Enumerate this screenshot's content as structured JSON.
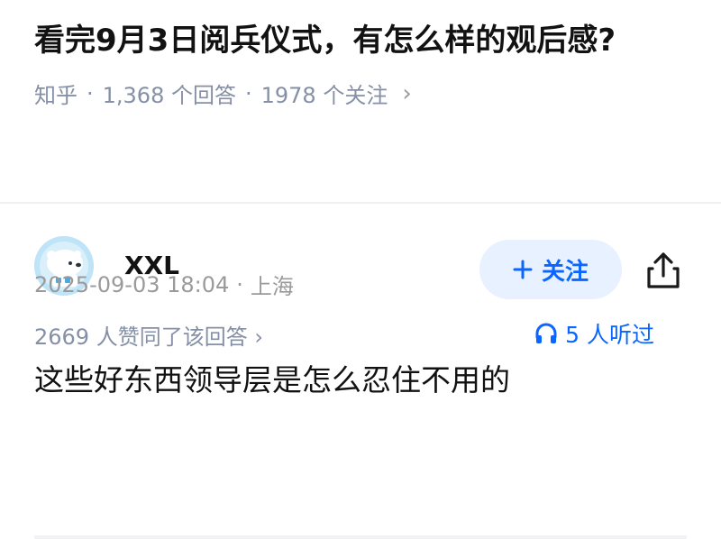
{
  "question": {
    "title": "看完9月3日阅兵仪式，有怎么样的观后感?",
    "source": "知乎",
    "separator": "·",
    "answers_count": "1,368 个回答",
    "followers_count": "1978 个关注"
  },
  "answer": {
    "author_name": "XXL",
    "follow_label": "关注",
    "likes_text": "2669 人赞同了该回答",
    "listeners_text": "5 人听过",
    "content": "这些好东西领导层是怎么忍住不用的",
    "timestamp": "2025-09-03 18:04",
    "location": "上海"
  },
  "colors": {
    "accent": "#0a66ff",
    "follow_bg": "#e8f1ff",
    "meta_text": "#8590a6"
  },
  "icons": {
    "avatar": "polar-bear-avatar",
    "follow": "plus-icon",
    "share": "share-icon",
    "listen": "headphones-icon",
    "chevron": "chevron-right-icon"
  }
}
